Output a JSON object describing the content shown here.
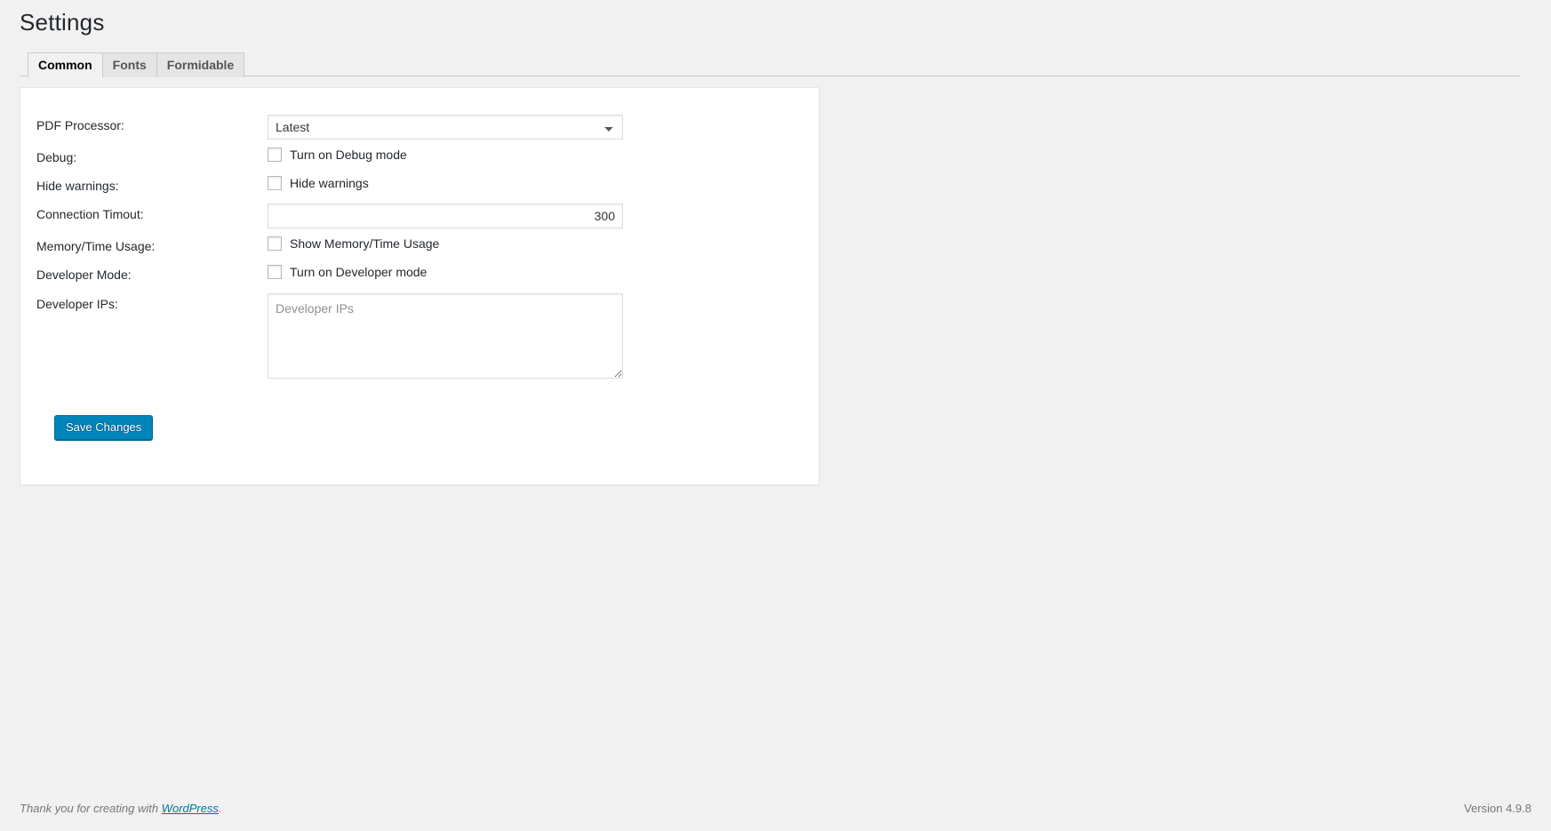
{
  "page": {
    "title": "Settings"
  },
  "tabs": [
    {
      "label": "Common",
      "active": true
    },
    {
      "label": "Fonts",
      "active": false
    },
    {
      "label": "Formidable",
      "active": false
    }
  ],
  "form": {
    "pdf_processor": {
      "label": "PDF Processor:",
      "selected": "Latest",
      "options": [
        "Latest"
      ]
    },
    "debug": {
      "label": "Debug:",
      "checkbox_label": "Turn on Debug mode",
      "checked": false
    },
    "hide_warnings": {
      "label": "Hide warnings:",
      "checkbox_label": "Hide warnings",
      "checked": false
    },
    "connection_timeout": {
      "label": "Connection Timout:",
      "value": "300"
    },
    "memory_time_usage": {
      "label": "Memory/Time Usage:",
      "checkbox_label": "Show Memory/Time Usage",
      "checked": false
    },
    "developer_mode": {
      "label": "Developer Mode:",
      "checkbox_label": "Turn on Developer mode",
      "checked": false
    },
    "developer_ips": {
      "label": "Developer IPs:",
      "value": "",
      "placeholder": "Developer IPs"
    },
    "submit": {
      "label": "Save Changes"
    }
  },
  "footer": {
    "thanks_prefix": "Thank you for creating with ",
    "link_label": "WordPress",
    "thanks_suffix": ".",
    "version": "Version 4.9.8"
  },
  "colors": {
    "background": "#f1f1f1",
    "panel": "#ffffff",
    "accent": "#0085ba",
    "link": "#0073aa",
    "border": "#cccccc",
    "text": "#23282d"
  }
}
